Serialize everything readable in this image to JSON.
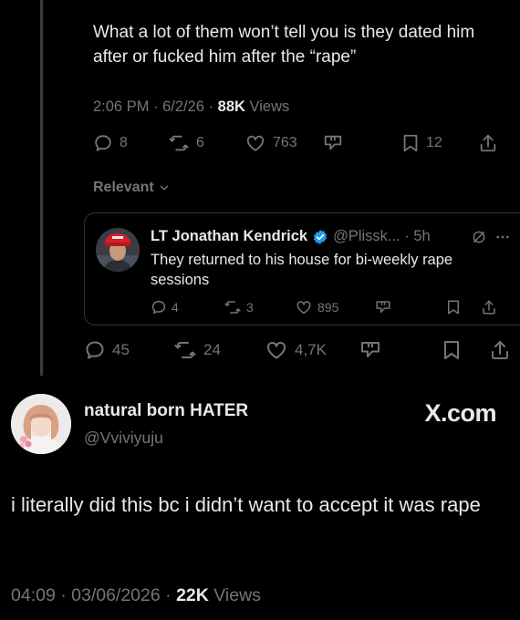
{
  "quoted_post": {
    "text": "What a lot of them won’t tell you is they dated him after or fucked him after the “rape”",
    "time": "2:06 PM · 6/2/26 · ",
    "views_count": "88K",
    "views_label": " Views",
    "replies": "8",
    "reposts": "6",
    "likes": "763",
    "bookmarks": "12"
  },
  "sort_filter": {
    "label": "Relevant"
  },
  "reply": {
    "name": "LT Jonathan Kendrick",
    "handle_time": "@Plissk... · 5h",
    "text": "They returned to his house for bi-weekly rape sessions",
    "replies": "4",
    "reposts": "3",
    "likes": "895"
  },
  "thread_stats": {
    "replies": "45",
    "reposts": "24",
    "likes": "4,7K"
  },
  "main_post": {
    "name": "natural born HATER",
    "handle": "@Vviviyuju",
    "brand": "X.com",
    "text": "i literally did this bc i didn’t want to accept it was rape",
    "time": "04:09 · 03/06/2026 · ",
    "views_count": "22K",
    "views_label": " Views"
  },
  "colors": {
    "background": "#000000",
    "text": "#e7e9ea",
    "secondary": "#71767b",
    "verified": "#1d9bf0"
  }
}
